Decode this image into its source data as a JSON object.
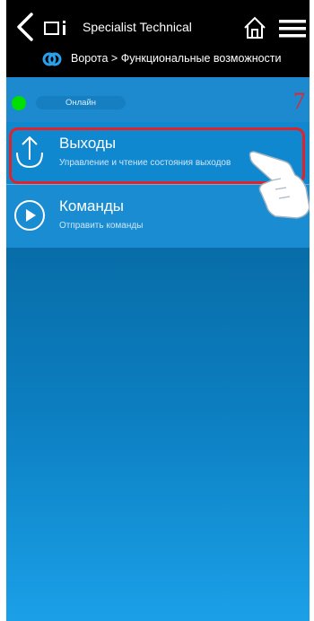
{
  "header": {
    "title": "Specialist Technical",
    "breadcrumb": "Ворота > Функциональные возможности"
  },
  "status": {
    "label": "Онлайн",
    "color": "#00e000"
  },
  "annotation": {
    "step": "7",
    "color": "#e3262b"
  },
  "items": [
    {
      "label": "Выходы",
      "description": "Управление и чтение состояния выходов",
      "icon": "upload-arrow-icon"
    },
    {
      "label": "Команды",
      "description": "Отправить команды",
      "icon": "play-icon"
    }
  ],
  "colors": {
    "header_bg": "#000000",
    "accent": "#1088d0",
    "highlight": "#e22229"
  }
}
